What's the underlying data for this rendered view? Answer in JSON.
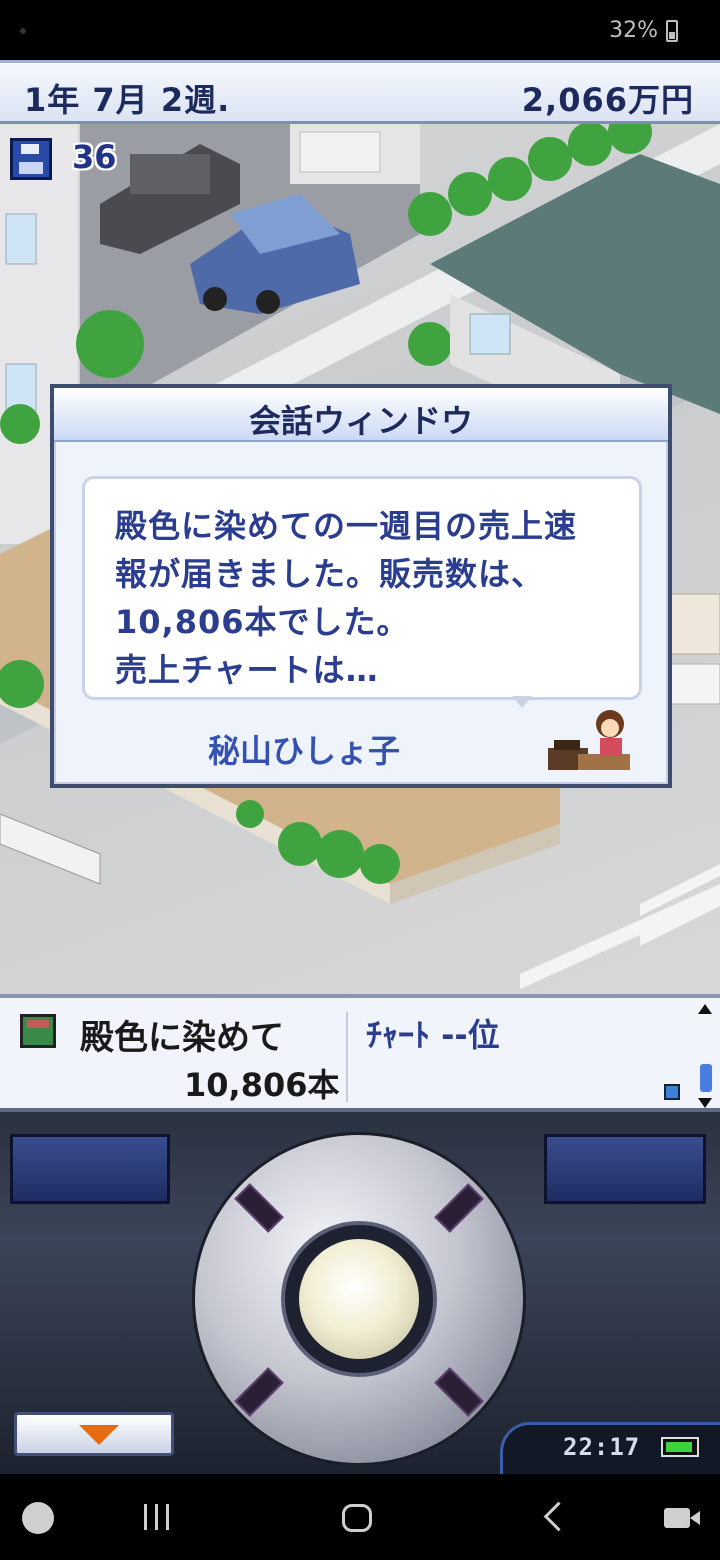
{
  "status_bar": {
    "battery_percent": "32%"
  },
  "top_bar": {
    "date": "1年 7月 2週.",
    "money": "2,066万円"
  },
  "hud": {
    "save_count": "36"
  },
  "dialog": {
    "title": "会話ウィンドウ",
    "message_lines": [
      "殿色に染めての一週目の売上速",
      "報が届きました。販売数は、",
      "10,806本でした。",
      "売上チャートは…"
    ],
    "speaker": "秘山ひしょ子"
  },
  "info_bar": {
    "game_title": "殿色に染めて",
    "sales": "10,806本",
    "chart_rank": "ﾁｬｰﾄ --位"
  },
  "controller": {
    "clock": "22:17"
  },
  "icons": {
    "save": "floppy-disk-icon",
    "avatar": "secretary-avatar",
    "menu_down": "triangle-down-icon"
  },
  "colors": {
    "accent_text": "#2a3d8f",
    "dialog_border": "#3e4d6e",
    "down_arrow": "#e96b10"
  }
}
